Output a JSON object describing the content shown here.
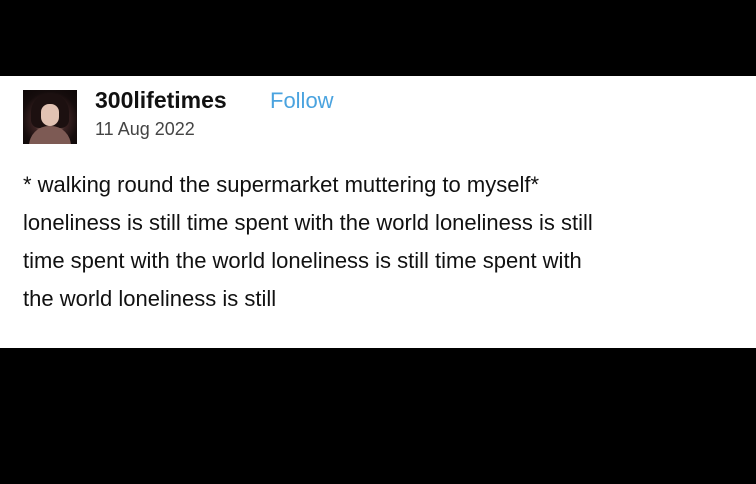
{
  "post": {
    "author": "300lifetimes",
    "follow_label": "Follow",
    "date": "11 Aug 2022",
    "body_lines": [
      "* walking round the supermarket muttering to myself*",
      "loneliness is still time spent with the world loneliness is still",
      "time spent with the world loneliness is still time spent with",
      "the world loneliness is still"
    ]
  },
  "colors": {
    "background": "#000000",
    "card": "#ffffff",
    "follow": "#4aa3df",
    "text": "#111111"
  },
  "icons": {
    "avatar": "profile-avatar-image"
  }
}
